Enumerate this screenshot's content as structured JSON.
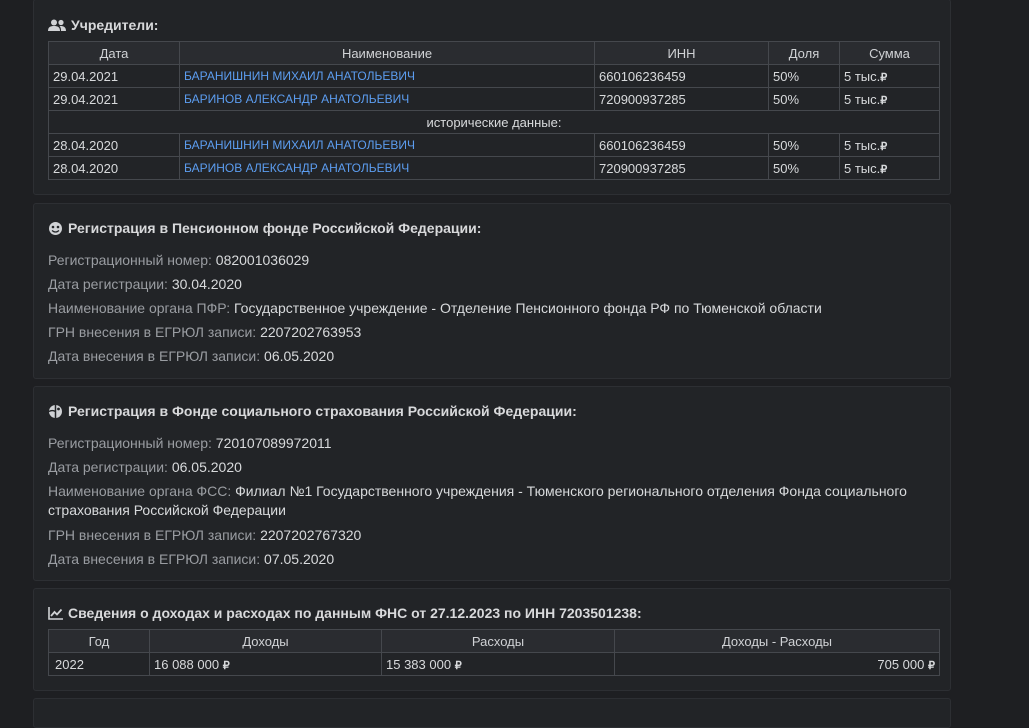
{
  "founders": {
    "title": "Учредители:",
    "columns": [
      "Дата",
      "Наименование",
      "ИНН",
      "Доля",
      "Сумма"
    ],
    "rows": [
      {
        "date": "29.04.2021",
        "name": "БАРАНИШНИН МИХАИЛ АНАТОЛЬЕВИЧ",
        "inn": "660106236459",
        "share": "50%",
        "sum": "5 тыс."
      },
      {
        "date": "29.04.2021",
        "name": "БАРИНОВ АЛЕКСАНДР АНАТОЛЬЕВИЧ",
        "inn": "720900937285",
        "share": "50%",
        "sum": "5 тыс."
      }
    ],
    "historic_label": "исторические данные:",
    "historic_rows": [
      {
        "date": "28.04.2020",
        "name": "БАРАНИШНИН МИХАИЛ АНАТОЛЬЕВИЧ",
        "inn": "660106236459",
        "share": "50%",
        "sum": "5 тыс."
      },
      {
        "date": "28.04.2020",
        "name": "БАРИНОВ АЛЕКСАНДР АНАТОЛЬЕВИЧ",
        "inn": "720900937285",
        "share": "50%",
        "sum": "5 тыс."
      }
    ],
    "currency": "₽"
  },
  "pfr": {
    "title": "Регистрация в Пенсионном фонде Российской Федерации:",
    "reg_number_label": "Регистрационный номер:",
    "reg_number": "082001036029",
    "reg_date_label": "Дата регистрации:",
    "reg_date": "30.04.2020",
    "org_label": "Наименование органа ПФР:",
    "org": "Государственное учреждение - Отделение Пенсионного фонда РФ по Тюменской области",
    "grn_label": "ГРН внесения в ЕГРЮЛ записи:",
    "grn": "2207202763953",
    "egrul_date_label": "Дата внесения в ЕГРЮЛ записи:",
    "egrul_date": "06.05.2020"
  },
  "fss": {
    "title": "Регистрация в Фонде социального страхования Российской Федерации:",
    "reg_number_label": "Регистрационный номер:",
    "reg_number": "720107089972011",
    "reg_date_label": "Дата регистрации:",
    "reg_date": "06.05.2020",
    "org_label": "Наименование органа ФСС:",
    "org": "Филиал №1 Государственного учреждения - Тюменского регионального отделения Фонда социального страхования Российской Федерации",
    "grn_label": "ГРН внесения в ЕГРЮЛ записи:",
    "grn": "2207202767320",
    "egrul_date_label": "Дата внесения в ЕГРЮЛ записи:",
    "egrul_date": "07.05.2020"
  },
  "finance": {
    "title": "Сведения о доходах и расходах по данным ФНС от 27.12.2023 по ИНН 7203501238:",
    "columns": [
      "Год",
      "Доходы",
      "Расходы",
      "Доходы - Расходы"
    ],
    "rows": [
      {
        "year": "2022",
        "income": "16 088 000",
        "expenses": "15 383 000",
        "diff": "705 000"
      }
    ]
  }
}
